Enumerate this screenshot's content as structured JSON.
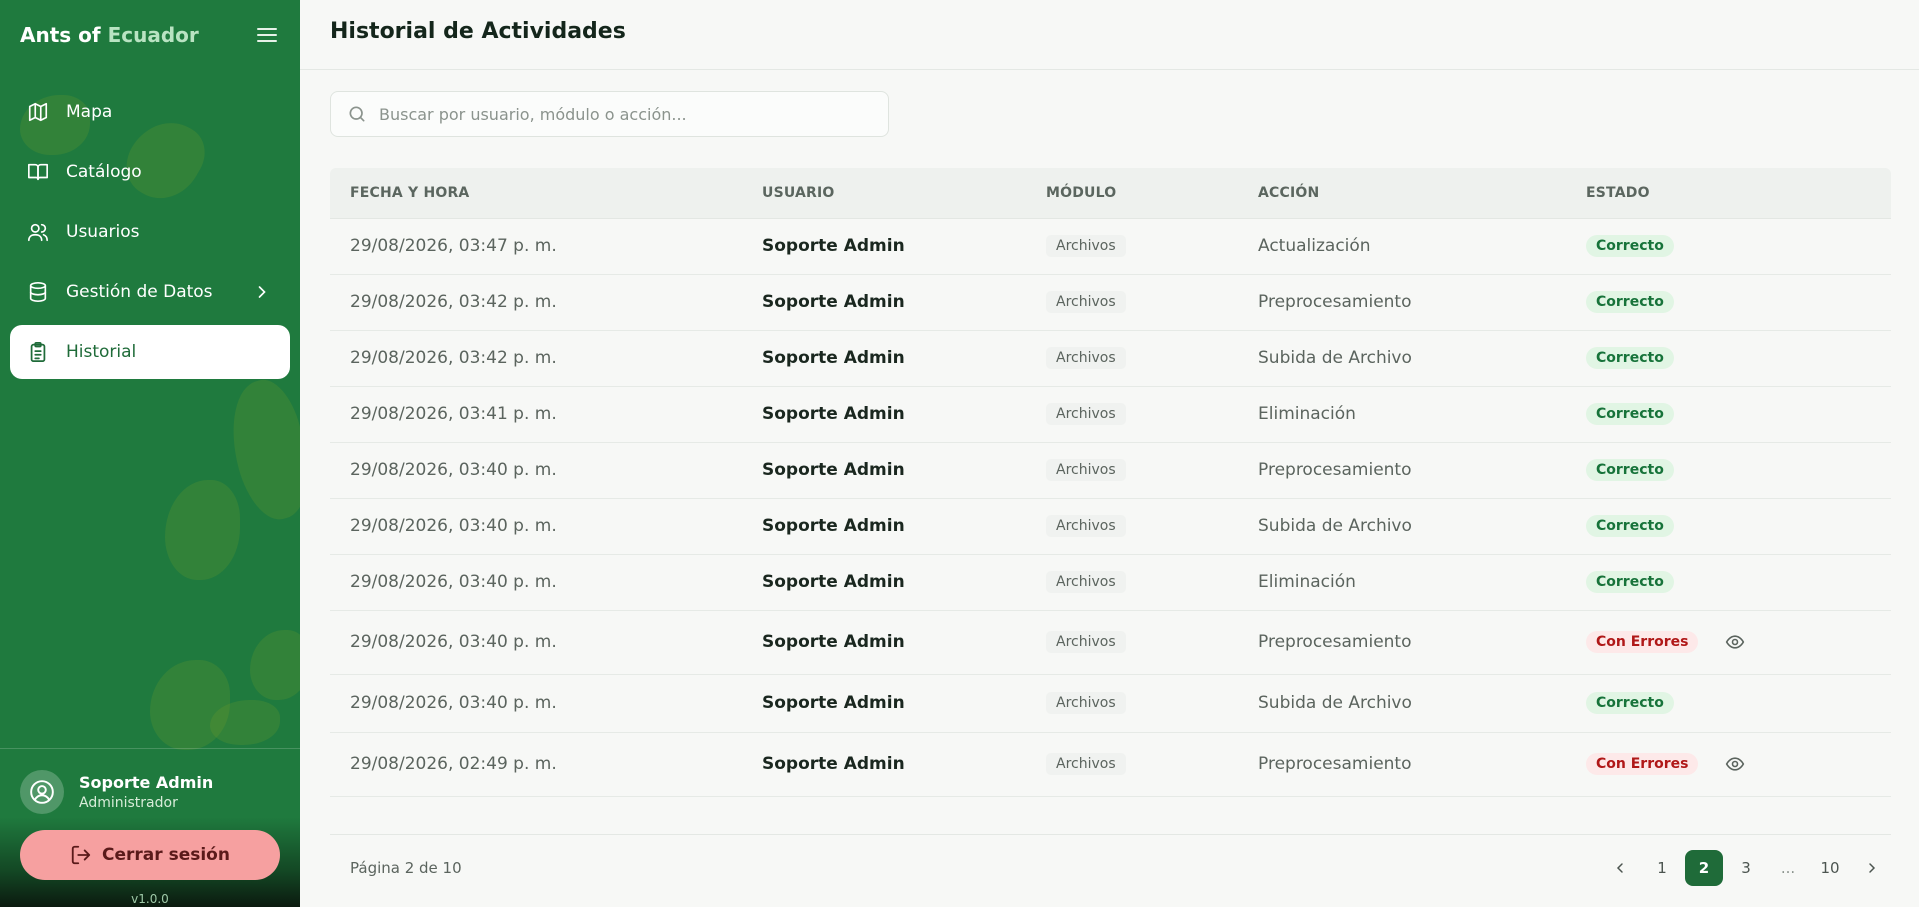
{
  "brand": {
    "part1": "Ants of",
    "part2": "Ecuador"
  },
  "sidebar": {
    "items": [
      {
        "label": "Mapa",
        "icon": "map-icon"
      },
      {
        "label": "Catálogo",
        "icon": "book-icon"
      },
      {
        "label": "Usuarios",
        "icon": "users-icon"
      },
      {
        "label": "Gestión de Datos",
        "icon": "database-icon"
      },
      {
        "label": "Historial",
        "icon": "clipboard-icon",
        "active": true
      }
    ],
    "user": {
      "name": "Soporte Admin",
      "role": "Administrador"
    },
    "logout_label": "Cerrar sesión",
    "version": "v1.0.0"
  },
  "main": {
    "title": "Historial de Actividades",
    "search_placeholder": "Buscar por usuario, módulo o acción...",
    "columns": [
      "FECHA Y HORA",
      "USUARIO",
      "MÓDULO",
      "ACCIÓN",
      "ESTADO"
    ],
    "rows": [
      {
        "date": "29/08/2026, 03:47 p. m.",
        "user": "Soporte Admin",
        "module": "Archivos",
        "action": "Actualización",
        "status": "Correcto"
      },
      {
        "date": "29/08/2026, 03:42 p. m.",
        "user": "Soporte Admin",
        "module": "Archivos",
        "action": "Preprocesamiento",
        "status": "Correcto"
      },
      {
        "date": "29/08/2026, 03:42 p. m.",
        "user": "Soporte Admin",
        "module": "Archivos",
        "action": "Subida de Archivo",
        "status": "Correcto"
      },
      {
        "date": "29/08/2026, 03:41 p. m.",
        "user": "Soporte Admin",
        "module": "Archivos",
        "action": "Eliminación",
        "status": "Correcto"
      },
      {
        "date": "29/08/2026, 03:40 p. m.",
        "user": "Soporte Admin",
        "module": "Archivos",
        "action": "Preprocesamiento",
        "status": "Correcto"
      },
      {
        "date": "29/08/2026, 03:40 p. m.",
        "user": "Soporte Admin",
        "module": "Archivos",
        "action": "Subida de Archivo",
        "status": "Correcto"
      },
      {
        "date": "29/08/2026, 03:40 p. m.",
        "user": "Soporte Admin",
        "module": "Archivos",
        "action": "Eliminación",
        "status": "Correcto"
      },
      {
        "date": "29/08/2026, 03:40 p. m.",
        "user": "Soporte Admin",
        "module": "Archivos",
        "action": "Preprocesamiento",
        "status": "Con Errores"
      },
      {
        "date": "29/08/2026, 03:40 p. m.",
        "user": "Soporte Admin",
        "module": "Archivos",
        "action": "Subida de Archivo",
        "status": "Correcto"
      },
      {
        "date": "29/08/2026, 02:49 p. m.",
        "user": "Soporte Admin",
        "module": "Archivos",
        "action": "Preprocesamiento",
        "status": "Con Errores"
      }
    ],
    "pagination": {
      "info": "Página 2 de 10",
      "pages": [
        "1",
        "2",
        "3",
        "...",
        "10"
      ],
      "current": "2"
    }
  },
  "colors": {
    "sidebar_bg": "#1f7a3e",
    "accent": "#1f6b39",
    "ok": "#17733a",
    "error": "#b01818",
    "logout_bg": "#f6a0a0"
  }
}
